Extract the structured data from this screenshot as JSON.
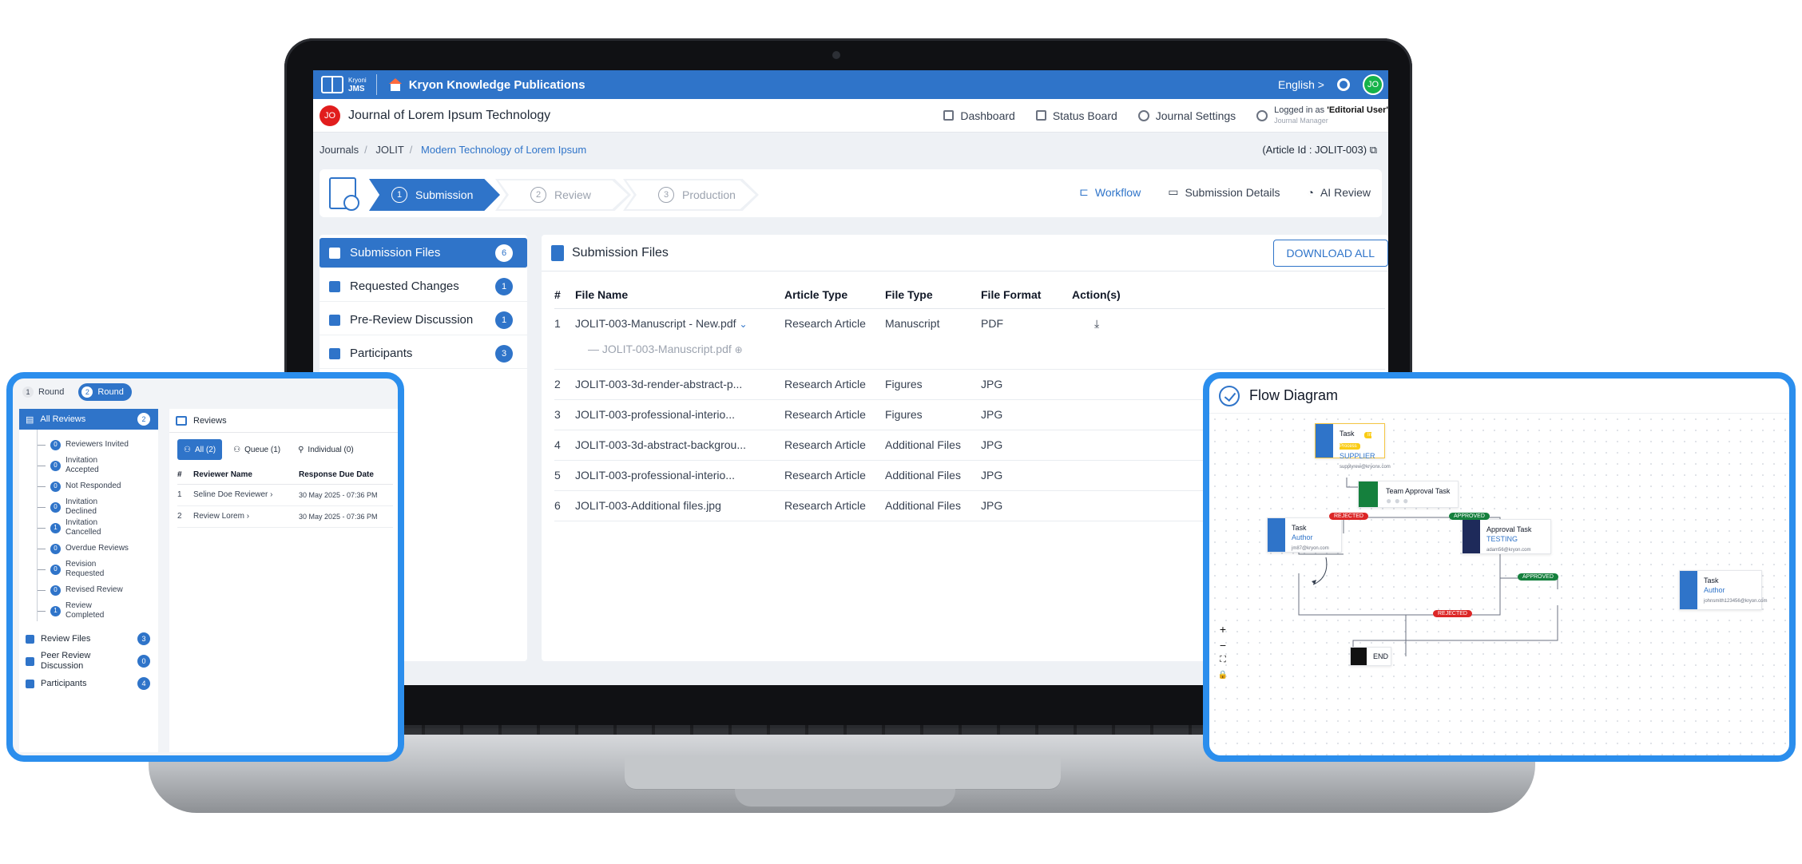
{
  "app": {
    "logo_line1": "Kryoni",
    "logo_line2": "JMS",
    "org_title": "Kryon Knowledge Publications",
    "language": "English",
    "user_initials": "JO"
  },
  "journal": {
    "initials": "JO",
    "title": "Journal of Lorem Ipsum Technology",
    "nav": [
      "Dashboard",
      "Status Board",
      "Journal Settings"
    ],
    "login_prefix": "Logged in as",
    "login_role": "'Editorial User'",
    "login_sub": "Journal Manager"
  },
  "breadcrumb": {
    "items": [
      "Journals",
      "JOLIT"
    ],
    "active": "Modern Technology of Lorem Ipsum",
    "article_id": "(Article Id : JOLIT-003)"
  },
  "workflow": {
    "steps": [
      {
        "num": "1",
        "label": "Submission"
      },
      {
        "num": "2",
        "label": "Review"
      },
      {
        "num": "3",
        "label": "Production"
      }
    ],
    "actions": [
      "Workflow",
      "Submission Details",
      "AI Review"
    ]
  },
  "left_tabs": [
    {
      "label": "Submission Files",
      "count": "6"
    },
    {
      "label": "Requested Changes",
      "count": "1"
    },
    {
      "label": "Pre-Review Discussion",
      "count": "1"
    },
    {
      "label": "Participants",
      "count": "3"
    }
  ],
  "files": {
    "title": "Submission Files",
    "download_all": "DOWNLOAD ALL",
    "columns": [
      "#",
      "File Name",
      "Article Type",
      "File Type",
      "File Format",
      "Action(s)"
    ],
    "rows": [
      {
        "n": "1",
        "name": "JOLIT-003-Manuscript - New.pdf",
        "article": "Research Article",
        "type": "Manuscript",
        "format": "PDF"
      },
      {
        "n": "2",
        "name": "JOLIT-003-3d-render-abstract-p...",
        "article": "Research Article",
        "type": "Figures",
        "format": "JPG"
      },
      {
        "n": "3",
        "name": "JOLIT-003-professional-interio...",
        "article": "Research Article",
        "type": "Figures",
        "format": "JPG"
      },
      {
        "n": "4",
        "name": "JOLIT-003-3d-abstract-backgrou...",
        "article": "Research Article",
        "type": "Additional Files",
        "format": "JPG"
      },
      {
        "n": "5",
        "name": "JOLIT-003-professional-interio...",
        "article": "Research Article",
        "type": "Additional Files",
        "format": "JPG"
      },
      {
        "n": "6",
        "name": "JOLIT-003-Additional files.jpg",
        "article": "Research Article",
        "type": "Additional Files",
        "format": "JPG"
      }
    ],
    "sub_file": "JOLIT-003-Manuscript.pdf"
  },
  "reviews_card": {
    "rounds": [
      {
        "n": "1",
        "label": "Round"
      },
      {
        "n": "2",
        "label": "Round"
      }
    ],
    "all_reviews": "All Reviews",
    "all_reviews_count": "2",
    "statuses": [
      {
        "label": "Reviewers Invited",
        "count": "0"
      },
      {
        "label": "Invitation Accepted",
        "count": "0"
      },
      {
        "label": "Not Responded",
        "count": "0"
      },
      {
        "label": "Invitation Declined",
        "count": "0"
      },
      {
        "label": "Invitation Cancelled",
        "count": "1"
      },
      {
        "label": "Overdue Reviews",
        "count": "0"
      },
      {
        "label": "Revision Requested",
        "count": "0"
      },
      {
        "label": "Revised Review",
        "count": "0"
      },
      {
        "label": "Review Completed",
        "count": "1"
      }
    ],
    "sections": [
      {
        "label": "Review Files",
        "count": "3"
      },
      {
        "label": "Peer Review Discussion",
        "count": "0"
      },
      {
        "label": "Participants",
        "count": "4"
      }
    ],
    "reviews_title": "Reviews",
    "tabs": [
      "All (2)",
      "Queue (1)",
      "Individual (0)"
    ],
    "columns": [
      "#",
      "Reviewer Name",
      "Response Due Date"
    ],
    "rows": [
      {
        "n": "1",
        "name": "Seline Doe Reviewer",
        "due": "30 May 2025 - 07:36 PM"
      },
      {
        "n": "2",
        "name": "Review Lorem",
        "due": "30 May 2025 - 07:36 PM"
      }
    ]
  },
  "flow": {
    "title": "Flow Diagram",
    "nodes": {
      "supplier": {
        "label": "Task",
        "badge": "In Process",
        "role": "SUPPLIER",
        "mail": "supplyrew@kryonx.com"
      },
      "team": {
        "label": "Team Approval Task"
      },
      "author": {
        "label": "Task",
        "role": "Author",
        "mail": "jm87@kryon.com"
      },
      "approval": {
        "label": "Approval Task",
        "role": "TESTING",
        "mail": "adam56@kryon.com"
      },
      "author2": {
        "label": "Task",
        "role": "Author",
        "mail": "johnsmith123456@kryon.com"
      },
      "end": {
        "label": "END"
      }
    },
    "badges": {
      "rejected": "REJECTED",
      "approved": "APPROVED"
    },
    "controls": [
      "+",
      "−",
      "⛶",
      "🔒"
    ]
  },
  "colors": {
    "primary": "#2f74c9",
    "card_border": "#2b8eed",
    "approved": "#15803d",
    "rejected": "#dc2626"
  }
}
